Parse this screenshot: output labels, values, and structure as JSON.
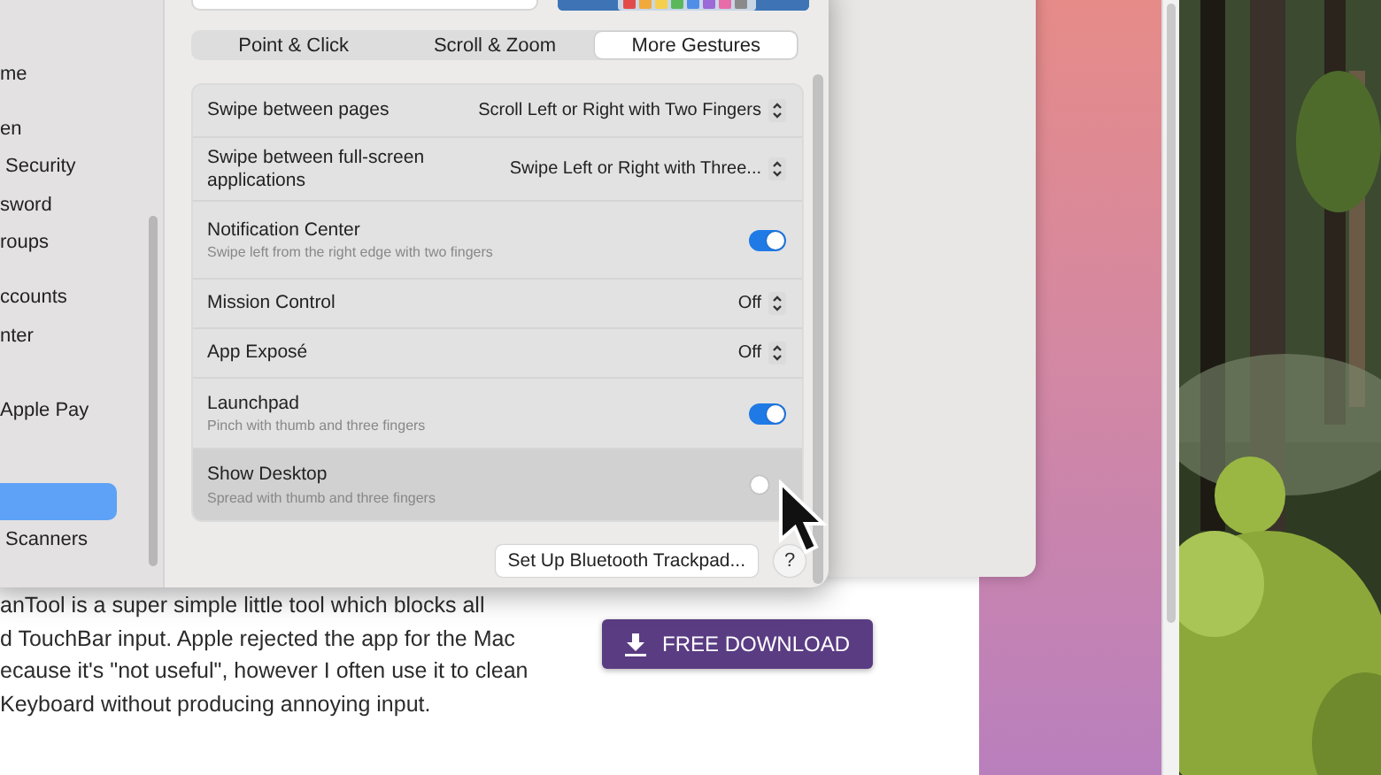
{
  "sidebar": {
    "items": [
      {
        "label": "me",
        "selected": false
      },
      {
        "label": "en",
        "selected": false
      },
      {
        "label": " Security",
        "selected": false
      },
      {
        "label": "sword",
        "selected": false
      },
      {
        "label": "roups",
        "selected": false
      },
      {
        "label": "ccounts",
        "selected": false
      },
      {
        "label": "nter",
        "selected": false
      },
      {
        "label": "Apple Pay",
        "selected": false
      },
      {
        "selected": true
      },
      {
        "label": " Scanners",
        "selected": false
      }
    ]
  },
  "tabs": [
    {
      "label": "Point & Click",
      "selected": false
    },
    {
      "label": "Scroll & Zoom",
      "selected": false
    },
    {
      "label": "More Gestures",
      "selected": true
    }
  ],
  "settings": [
    {
      "kind": "select",
      "title": "Swipe between pages",
      "value": "Scroll Left or Right with Two Fingers",
      "highlighted": false
    },
    {
      "kind": "select",
      "title": "Swipe between full-screen applications",
      "value": "Swipe Left or Right with Three...",
      "highlighted": false
    },
    {
      "kind": "toggle",
      "title": "Notification Center",
      "subtitle": "Swipe left from the right edge with two fingers",
      "on": true,
      "highlighted": false
    },
    {
      "kind": "select",
      "title": "Mission Control",
      "value": "Off",
      "highlighted": false
    },
    {
      "kind": "select",
      "title": "App Exposé",
      "value": "Off",
      "highlighted": false
    },
    {
      "kind": "toggle",
      "title": "Launchpad",
      "subtitle": "Pinch with thumb and three fingers",
      "on": true,
      "highlighted": false
    },
    {
      "kind": "toggle",
      "title": "Show Desktop",
      "subtitle": "Spread with thumb and three fingers",
      "on": false,
      "highlighted": true
    }
  ],
  "footer": {
    "button": "Set Up Bluetooth Trackpad...",
    "help": "?"
  },
  "web_page": {
    "paragraph_lines": [
      "anTool is a super simple little tool which blocks all",
      "d TouchBar input. Apple rejected the app for the Mac",
      "ecause it's \"not useful\", however I often use it to clean",
      "Keyboard without producing annoying input."
    ],
    "download_button": "FREE DOWNLOAD"
  }
}
